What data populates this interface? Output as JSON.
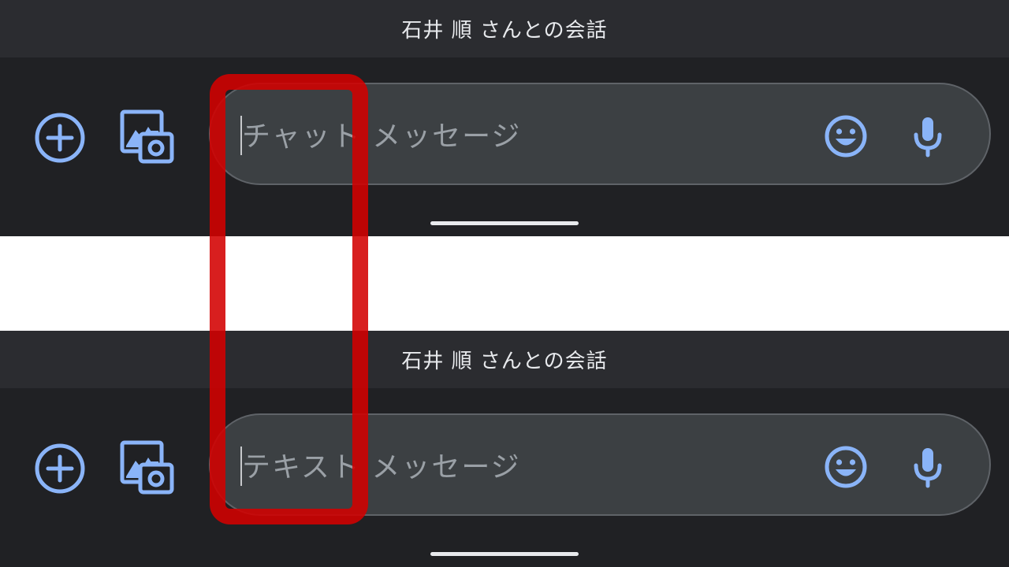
{
  "colors": {
    "panel_bg": "#202124",
    "header_bg": "#2b2c30",
    "field_bg": "#3c4043",
    "icon_accent": "#8ab4f8",
    "highlight": "#d30000"
  },
  "top": {
    "header_title": "石井 順 さんとの会話",
    "placeholder": "チャット メッセージ",
    "icons": {
      "add": "add-circle-icon",
      "gallery": "gallery-camera-icon",
      "emoji": "emoji-icon",
      "mic": "microphone-icon"
    }
  },
  "bottom": {
    "header_title": "石井 順 さんとの会話",
    "placeholder": "テキスト メッセージ",
    "icons": {
      "add": "add-circle-icon",
      "gallery": "gallery-camera-icon",
      "emoji": "emoji-icon",
      "mic": "microphone-icon"
    }
  }
}
